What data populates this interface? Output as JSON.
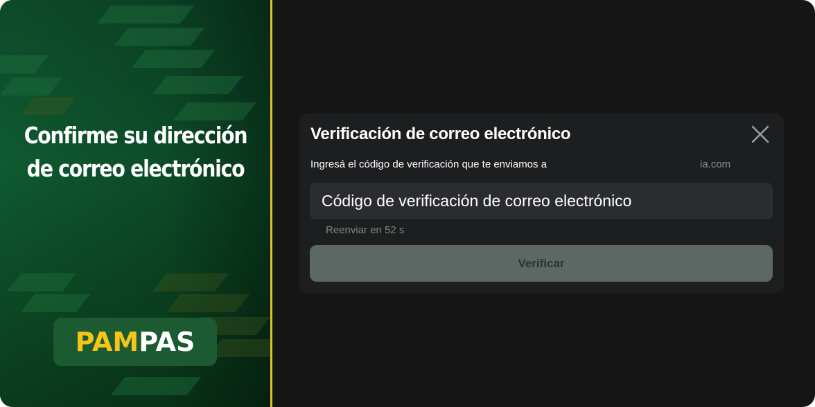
{
  "promo": {
    "headline_line1": "Confirme su dirección",
    "headline_line2": "de correo electrónico",
    "logo_part1": "PAM",
    "logo_part2": "PAS"
  },
  "dialog": {
    "title": "Verificación de correo electrónico",
    "subtitle": "Ingresá el código de verificación que te enviamos a",
    "email_fragment": "ia.com",
    "code_placeholder": "Código de verificación de correo electrónico",
    "resend_label": "Reenviar en 52 s",
    "verify_label": "Verificar",
    "close_icon": "close-icon"
  },
  "colors": {
    "accent_yellow": "#f5c518",
    "divider_yellow": "#e6c229",
    "promo_green": "#0f5a30",
    "dialog_bg": "#1d1e20",
    "verify_disabled": "#5b6863"
  }
}
